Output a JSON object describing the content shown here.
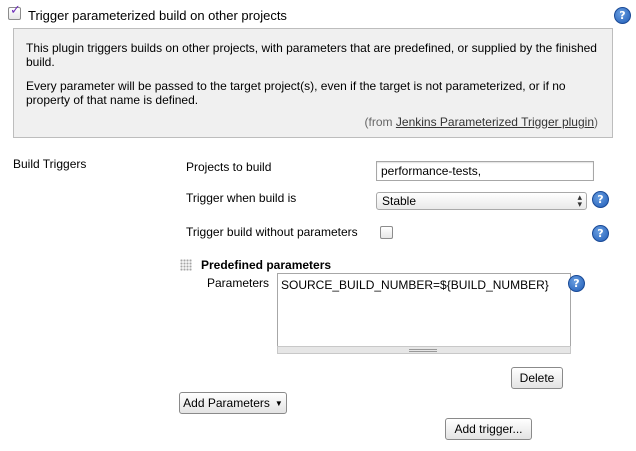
{
  "header": {
    "checkbox_checked": true,
    "title": "Trigger parameterized build on other projects"
  },
  "description": {
    "paragraph1": "This plugin triggers builds on other projects, with parameters that are predefined, or supplied by the finished build.",
    "paragraph2": "Every parameter will be passed to the target project(s), even if the target is not parameterized, or if no property of that name is defined.",
    "from_prefix": "(from ",
    "from_link": "Jenkins Parameterized Trigger plugin",
    "from_suffix": ")"
  },
  "section": {
    "label": "Build Triggers"
  },
  "fields": {
    "projects_label": "Projects to build",
    "projects_value": "performance-tests,",
    "trigger_when_label": "Trigger when build is",
    "trigger_when_value": "Stable",
    "without_params_label": "Trigger build without parameters",
    "without_params_checked": false
  },
  "predefined": {
    "title": "Predefined parameters",
    "parameters_label": "Parameters",
    "parameters_value": "SOURCE_BUILD_NUMBER=${BUILD_NUMBER}"
  },
  "buttons": {
    "delete": "Delete",
    "add_parameters": "Add Parameters",
    "add_trigger": "Add trigger..."
  },
  "icons": {
    "help": "?",
    "checkmark": "✓",
    "select_arrows": "▴▾",
    "dropdown_caret": "▼"
  },
  "colors": {
    "help_icon": "#1f5cb8",
    "description_bg": "#f0f0f0"
  }
}
